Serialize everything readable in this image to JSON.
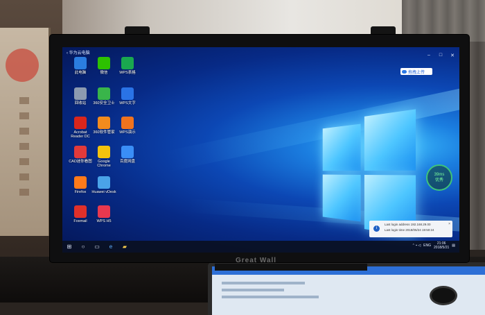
{
  "window": {
    "back_label": "‹ 华为云电脑",
    "controls": [
      "–",
      "□",
      "✕"
    ]
  },
  "upload_button": {
    "label": "拖拽上传",
    "icon": "cloud-icon"
  },
  "desktop_icons": [
    {
      "label": "此电脑",
      "icon": "pc-icon",
      "color": "#2b7de0"
    },
    {
      "label": "微信",
      "icon": "wechat-icon",
      "color": "#2dc100"
    },
    {
      "label": "WPS表格",
      "icon": "wps-spreadsheet-icon",
      "color": "#1aa84f"
    },
    {
      "label": "回收站",
      "icon": "recycle-bin-icon",
      "color": "#8c9bb0"
    },
    {
      "label": "360安全卫士",
      "icon": "360-safe-icon",
      "color": "#39b54a"
    },
    {
      "label": "WPS文字",
      "icon": "wps-writer-icon",
      "color": "#2a73e6"
    },
    {
      "label": "Acrobat Reader DC",
      "icon": "acrobat-icon",
      "color": "#d9261c"
    },
    {
      "label": "360软件管家",
      "icon": "360-software-icon",
      "color": "#f28b1e"
    },
    {
      "label": "WPS演示",
      "icon": "wps-presentation-icon",
      "color": "#f0731e"
    },
    {
      "label": "CAD迷你看图",
      "icon": "cad-viewer-icon",
      "color": "#e23a3a"
    },
    {
      "label": "Google Chrome",
      "icon": "chrome-icon",
      "color": "#f4c20d"
    },
    {
      "label": "百度网盘",
      "icon": "baidu-netdisk-icon",
      "color": "#3a8ef6"
    },
    {
      "label": "Firefox",
      "icon": "firefox-icon",
      "color": "#ff7a1a"
    },
    {
      "label": "Huawei vDesk",
      "icon": "vdesk-icon",
      "color": "#4aa3e8"
    },
    {
      "label": "",
      "icon": "",
      "color": ""
    },
    {
      "label": "Foxmail",
      "icon": "foxmail-icon",
      "color": "#e0302a"
    },
    {
      "label": "WPS H5",
      "icon": "wps-h5-icon",
      "color": "#e8384f"
    }
  ],
  "speed": {
    "value": "39ms",
    "status": "优秀"
  },
  "notification": {
    "line1": "Last login address 192.168.29.00",
    "line2": "Last login time    2018/05/24 19:50:24"
  },
  "taskbar": {
    "start_icon": "windows-start-icon",
    "clock_time": "21:06",
    "clock_date": "2018/5/21",
    "ime": "ENG"
  },
  "monitor": {
    "brand": "Great Wall"
  }
}
